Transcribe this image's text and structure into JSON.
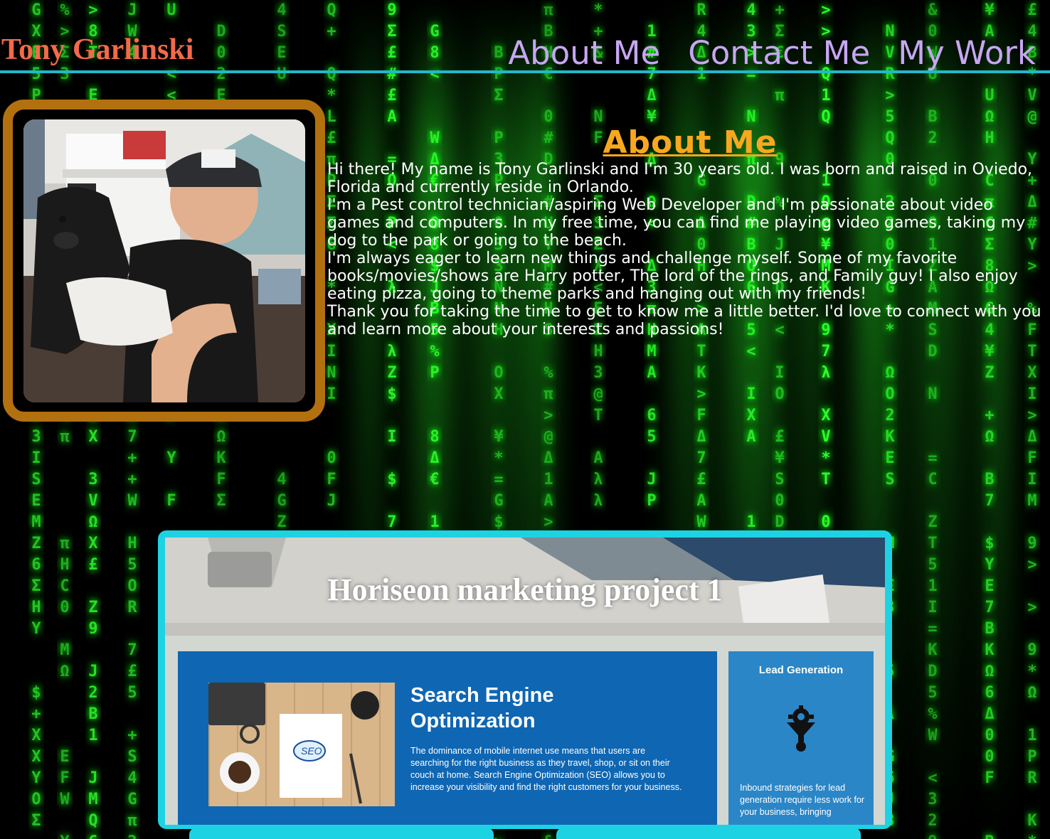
{
  "header": {
    "site_title": "Tony Garlinski",
    "nav": [
      {
        "label": "About Me"
      },
      {
        "label": "Contact Me"
      },
      {
        "label": "My Work"
      }
    ]
  },
  "about": {
    "heading": "About Me",
    "paragraphs": [
      "Hi there! My name is Tony Garlinski and I'm 30 years old. I was born and raised in Oviedo, Florida and currently reside in Orlando.",
      "I'm a Pest control technician/aspiring Web Developer and I'm passionate about video games and computers. In my free time, you can find me playing video games, taking my dog to the park or going to the beach.",
      "I'm always eager to learn new things and challenge myself. Some of my favorite books/movies/shows are Harry potter, The lord of the rings, and Family guy! I also enjoy eating pizza, going to theme parks and hanging out with my friends!",
      "Thank you for taking the time to get to know me a little better. I'd love to connect with you and learn more about your interests and passions!"
    ]
  },
  "project": {
    "title": "Horiseon marketing project 1",
    "seo": {
      "heading": "Search Engine Optimization",
      "text": "The dominance of mobile internet use means that users are searching for the right business as they travel, shop, or sit on their couch at home. Search Engine Optimization (SEO) allows you to increase your visibility and find the right customers for your business.",
      "image_label": "SEO"
    },
    "lead": {
      "title": "Lead Generation",
      "text": "Inbound strategies for lead generation require less work for your business, bringing"
    }
  },
  "colors": {
    "site_title": "#f36a4a",
    "nav": "#c7a6f2",
    "rule": "#22b8c9",
    "frame": "#b2700f",
    "heading": "#f8a81f",
    "card_border": "#1dd3e3"
  },
  "icons": [
    "profile-photo",
    "funnel-gear-icon"
  ]
}
